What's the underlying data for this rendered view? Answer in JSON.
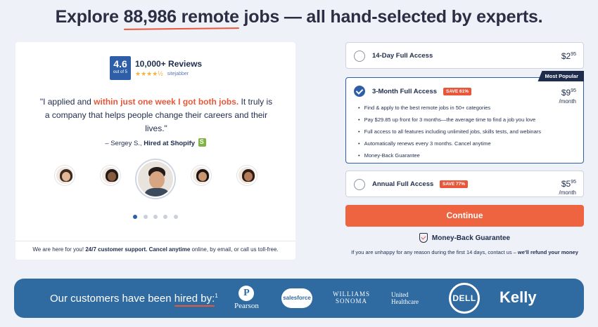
{
  "headline": {
    "prefix": "Explore ",
    "accent": "88,986 remote",
    "suffix": " jobs — all hand-selected by experts."
  },
  "testimonial": {
    "rating": {
      "score": "4.6",
      "out_of": "out of 5",
      "title": "10,000+ Reviews",
      "stars": "★★★★½",
      "source": "sitejabber"
    },
    "quote": {
      "open": "\"I applied and ",
      "highlight": "within just one week I got both jobs.",
      "close": " It truly is a company that helps people change their careers and their lives.\""
    },
    "author": "– Sergey S., ",
    "hired_at": "Hired at Shopify",
    "support": {
      "intro": "We are here for you! ",
      "bold": "24/7 customer support. Cancel anytime",
      "rest": " online, by email, or call us toll-free."
    }
  },
  "plans": [
    {
      "name": "14-Day Full Access",
      "price_whole": "$2",
      "price_cents": "95",
      "unit": "",
      "selected": false
    },
    {
      "name": "3-Month Full Access",
      "badge": "SAVE 61%",
      "popular": "Most Popular",
      "price_whole": "$9",
      "price_cents": "95",
      "unit": "/month",
      "selected": true,
      "features": [
        "Find & apply to the best remote jobs in 50+ categories",
        "Pay $29.85 up front for 3 months—the average time to find a job you love",
        "Full access to all features including unlimited jobs, skills tests, and webinars",
        "Automatically renews every 3 months. Cancel anytime",
        "Money-Back Guarantee"
      ]
    },
    {
      "name": "Annual Full Access",
      "badge": "SAVE 77%",
      "price_whole": "$5",
      "price_cents": "95",
      "unit": "/month",
      "selected": false
    }
  ],
  "continue_label": "Continue",
  "guarantee": {
    "title": "Money-Back Guarantee",
    "text": "If you are unhappy for any reason during the first 14 days, contact us – ",
    "bold": "we'll refund your money"
  },
  "banner": {
    "prefix": "Our customers have been ",
    "underlined": "hired by:",
    "sup": "1",
    "logos": {
      "pearson": "Pearson",
      "pearson_mark": "P",
      "salesforce": "salesforce",
      "williams_sonoma": [
        "WILLIAMS",
        "SONOMA"
      ],
      "united_healthcare": [
        "United",
        "Healthcare"
      ],
      "dell": "DELL",
      "kelly": "Kelly"
    }
  },
  "colors": {
    "accent": "#e8573a",
    "brand_blue": "#2f5ea8",
    "banner_blue": "#2f6aa0",
    "cta": "#ee6440"
  }
}
